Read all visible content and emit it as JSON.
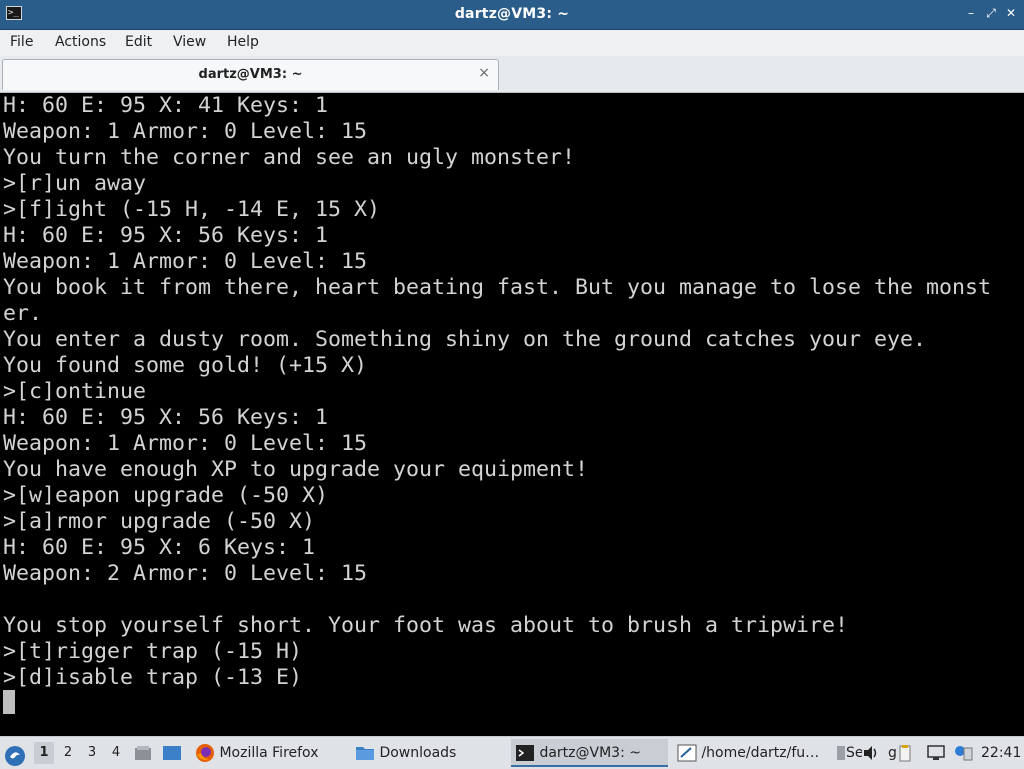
{
  "window": {
    "title": "dartz@VM3: ~",
    "controls": {
      "minimize": "–",
      "maximize": "⤢",
      "close": "✕"
    }
  },
  "menu": {
    "items": [
      "File",
      "Actions",
      "Edit",
      "View",
      "Help"
    ]
  },
  "tab": {
    "label": "dartz@VM3: ~",
    "close": "×"
  },
  "terminal": {
    "lines": [
      "H: 60 E: 95 X: 41 Keys: 1",
      "Weapon: 1 Armor: 0 Level: 15",
      "You turn the corner and see an ugly monster!",
      ">[r]un away",
      ">[f]ight (-15 H, -14 E, 15 X)",
      "H: 60 E: 95 X: 56 Keys: 1",
      "Weapon: 1 Armor: 0 Level: 15",
      "You book it from there, heart beating fast. But you manage to lose the monst",
      "er.",
      "You enter a dusty room. Something shiny on the ground catches your eye.",
      "You found some gold! (+15 X)",
      ">[c]ontinue",
      "H: 60 E: 95 X: 56 Keys: 1",
      "Weapon: 1 Armor: 0 Level: 15",
      "You have enough XP to upgrade your equipment!",
      ">[w]eapon upgrade (-50 X)",
      ">[a]rmor upgrade (-50 X)",
      "H: 60 E: 95 X: 6 Keys: 1",
      "Weapon: 2 Armor: 0 Level: 15",
      "",
      "You stop yourself short. Your foot was about to brush a tripwire!",
      ">[t]rigger trap (-15 H)",
      ">[d]isable trap (-13 E)"
    ],
    "colors": {
      "background": "#000000",
      "foreground": "#d3d3d3"
    }
  },
  "taskbar": {
    "workspaces": [
      "1",
      "2",
      "3",
      "4"
    ],
    "active_workspace": "1",
    "tasks": [
      {
        "label": "Mozilla Firefox",
        "icon": "firefox-icon"
      },
      {
        "label": "Downloads",
        "icon": "folder-icon"
      },
      {
        "label": "dartz@VM3: ~",
        "icon": "terminal-icon",
        "active": true
      },
      {
        "label": "/home/dartz/fu…",
        "icon": "text-editor-icon"
      },
      {
        "label": "Se",
        "icon": "app-icon"
      }
    ],
    "tray_text": "g",
    "clock": "22:41"
  }
}
